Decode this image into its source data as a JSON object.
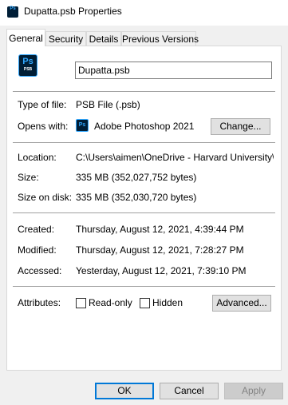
{
  "window": {
    "title": "Dupatta.psb Properties",
    "app_icon": "photoshop-file-icon"
  },
  "tabs": [
    {
      "label": "General",
      "active": true
    },
    {
      "label": "Security",
      "active": false
    },
    {
      "label": "Details",
      "active": false
    },
    {
      "label": "Previous Versions",
      "active": false
    }
  ],
  "general": {
    "file_icon": {
      "name": "psb-file-icon",
      "glyph": "Ps",
      "sub": "PSB"
    },
    "file_name": "Dupatta.psb",
    "type_label": "Type of file:",
    "type_value": "PSB File (.psb)",
    "opens_label": "Opens with:",
    "opens_value": "Adobe Photoshop 2021",
    "opens_glyph": "Ps",
    "change_button": "Change...",
    "location_label": "Location:",
    "location_value": "C:\\Users\\aimen\\OneDrive - Harvard University\\Pers",
    "size_label": "Size:",
    "size_value": "335 MB (352,027,752 bytes)",
    "size_on_disk_label": "Size on disk:",
    "size_on_disk_value": "335 MB (352,030,720 bytes)",
    "created_label": "Created:",
    "created_value": "Thursday, August 12, 2021, 4:39:44 PM",
    "modified_label": "Modified:",
    "modified_value": "Thursday, August 12, 2021, 7:28:27 PM",
    "accessed_label": "Accessed:",
    "accessed_value": "Yesterday, August 12, 2021, 7:39:10 PM",
    "attributes_label": "Attributes:",
    "readonly_label": "Read-only",
    "readonly_checked": false,
    "hidden_label": "Hidden",
    "hidden_checked": false,
    "advanced_button": "Advanced..."
  },
  "footer": {
    "ok": "OK",
    "cancel": "Cancel",
    "apply": "Apply"
  },
  "colors": {
    "accent": "#0078d7",
    "ps_dark": "#001e36",
    "ps_blue": "#31a8ff"
  }
}
